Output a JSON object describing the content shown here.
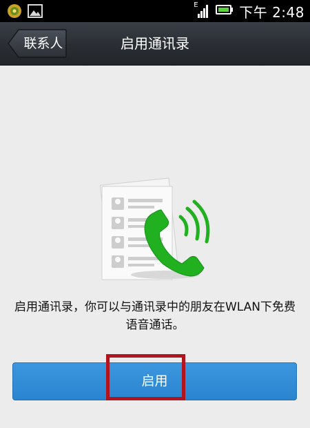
{
  "status_bar": {
    "left_icons": [
      "app-notification-icon",
      "image-icon"
    ],
    "right_icons": [
      "signal-e-icon",
      "battery-icon"
    ],
    "network_type": "E",
    "time": "下午 2:48"
  },
  "title_bar": {
    "back_label": "联系人",
    "title": "启用通讯录"
  },
  "content": {
    "illustration": "contacts-phone-icon",
    "description": "启用通讯录，你可以与通讯录中的朋友在WLAN下免费语音通话。",
    "enable_label": "启用"
  },
  "colors": {
    "status_bar_bg": "#000000",
    "title_bar_bg": "#2b2f35",
    "page_bg": "#ececec",
    "button_bg": "#2a84cf",
    "phone_green": "#1fb01f",
    "highlight_red": "#b0141e"
  }
}
